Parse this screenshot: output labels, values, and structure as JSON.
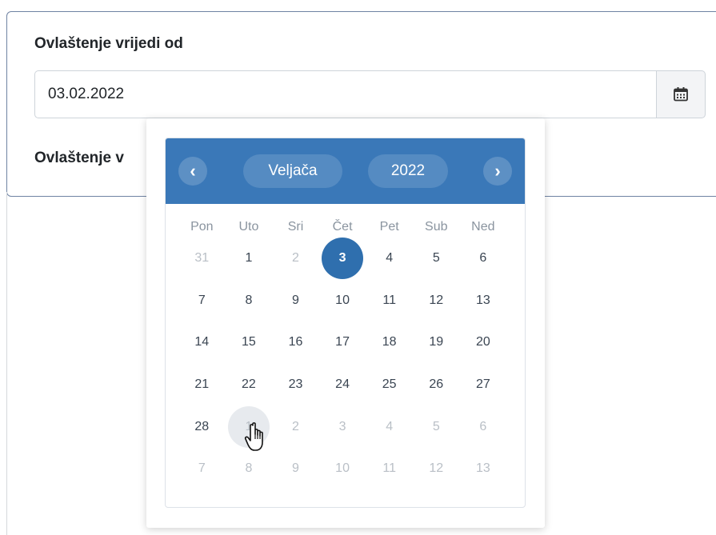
{
  "form": {
    "valid_from_label": "Ovlaštenje vrijedi od",
    "valid_from_value": "03.02.2022",
    "valid_to_label_visible": "Ovlaštenje v"
  },
  "calendar": {
    "prev_glyph": "‹",
    "next_glyph": "›",
    "month": "Veljača",
    "year": "2022",
    "weekdays": [
      "Pon",
      "Uto",
      "Sri",
      "Čet",
      "Pet",
      "Sub",
      "Ned"
    ],
    "weeks": [
      [
        {
          "d": "31",
          "m": true
        },
        {
          "d": "1"
        },
        {
          "d": "2",
          "m": true
        },
        {
          "d": "3",
          "sel": true
        },
        {
          "d": "4"
        },
        {
          "d": "5"
        },
        {
          "d": "6"
        }
      ],
      [
        {
          "d": "7"
        },
        {
          "d": "8"
        },
        {
          "d": "9"
        },
        {
          "d": "10"
        },
        {
          "d": "11"
        },
        {
          "d": "12"
        },
        {
          "d": "13"
        }
      ],
      [
        {
          "d": "14"
        },
        {
          "d": "15"
        },
        {
          "d": "16"
        },
        {
          "d": "17"
        },
        {
          "d": "18"
        },
        {
          "d": "19"
        },
        {
          "d": "20"
        }
      ],
      [
        {
          "d": "21"
        },
        {
          "d": "22"
        },
        {
          "d": "23"
        },
        {
          "d": "24"
        },
        {
          "d": "25"
        },
        {
          "d": "26"
        },
        {
          "d": "27"
        }
      ],
      [
        {
          "d": "28"
        },
        {
          "d": "1",
          "m": true,
          "hover": true
        },
        {
          "d": "2",
          "m": true
        },
        {
          "d": "3",
          "m": true
        },
        {
          "d": "4",
          "m": true
        },
        {
          "d": "5",
          "m": true
        },
        {
          "d": "6",
          "m": true
        }
      ],
      [
        {
          "d": "7",
          "m": true
        },
        {
          "d": "8",
          "m": true
        },
        {
          "d": "9",
          "m": true
        },
        {
          "d": "10",
          "m": true
        },
        {
          "d": "11",
          "m": true
        },
        {
          "d": "12",
          "m": true
        },
        {
          "d": "13",
          "m": true
        }
      ]
    ],
    "header_color": "#3a78b8",
    "selected_color": "#2f6fae"
  },
  "icons": {
    "calendar_button": "calendar-icon",
    "cursor": "hand-pointer-icon"
  }
}
